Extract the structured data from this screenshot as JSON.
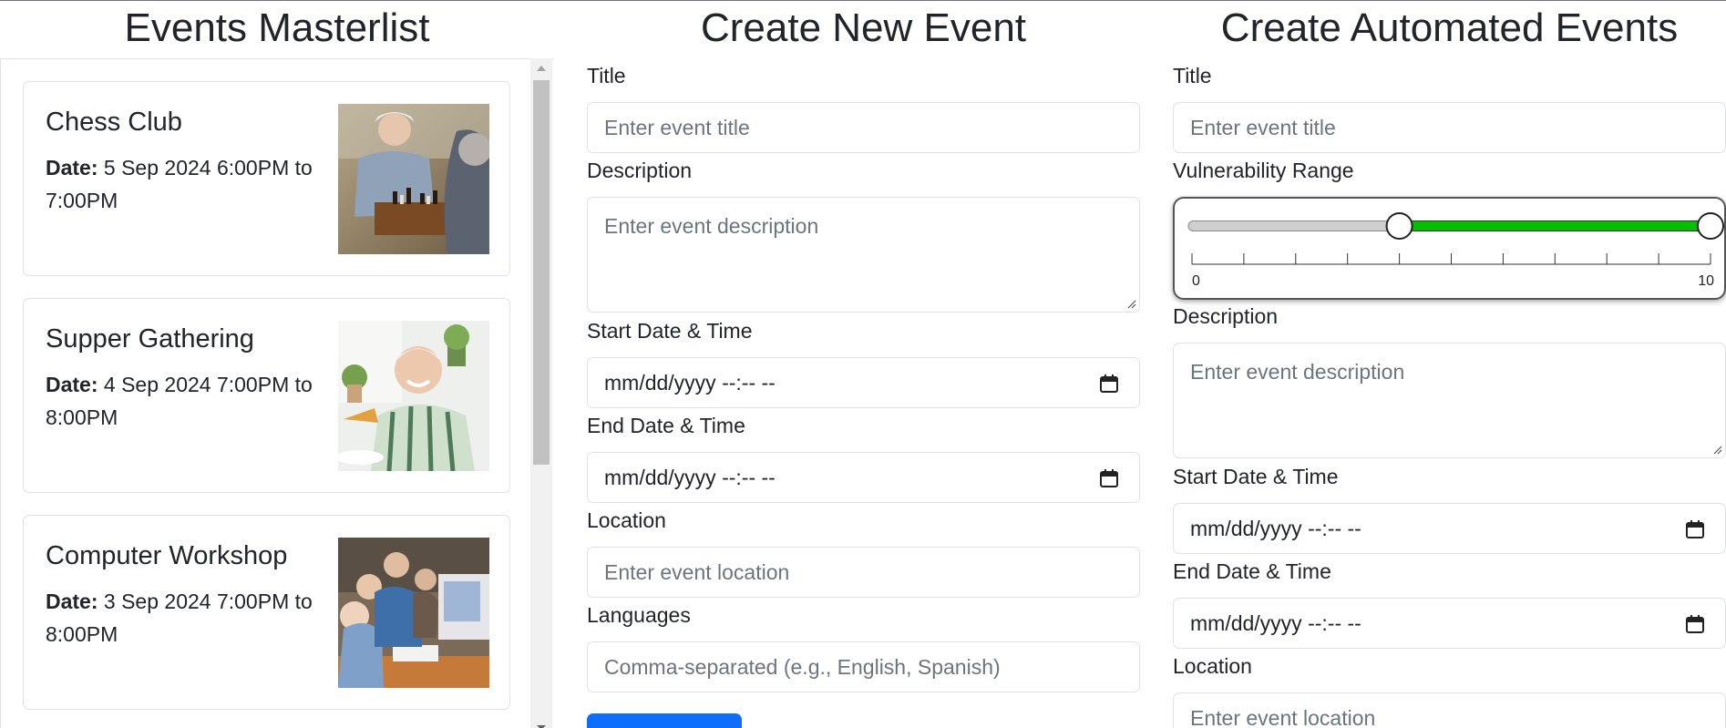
{
  "masterlist": {
    "title": "Events Masterlist",
    "events": [
      {
        "title": "Chess Club",
        "date_label": "Date:",
        "date_text": "5 Sep 2024 6:00PM to 7:00PM",
        "image": "chess-players-photo"
      },
      {
        "title": "Supper Gathering",
        "date_label": "Date:",
        "date_text": "4 Sep 2024 7:00PM to 8:00PM",
        "image": "man-eating-pizza-photo"
      },
      {
        "title": "Computer Workshop",
        "date_label": "Date:",
        "date_text": "3 Sep 2024 7:00PM to 8:00PM",
        "image": "seniors-at-computer-photo"
      }
    ]
  },
  "create_event": {
    "title": "Create New Event",
    "title_label": "Title",
    "title_placeholder": "Enter event title",
    "description_label": "Description",
    "description_placeholder": "Enter event description",
    "start_label": "Start Date & Time",
    "start_value": "mm/dd/yyyy --:-- --",
    "end_label": "End Date & Time",
    "end_value": "mm/dd/yyyy --:-- --",
    "location_label": "Location",
    "location_placeholder": "Enter event location",
    "languages_label": "Languages",
    "languages_placeholder": "Comma-separated (e.g., English, Spanish)"
  },
  "automated": {
    "title": "Create Automated Events",
    "title_label": "Title",
    "title_placeholder": "Enter event title",
    "range_label": "Vulnerability Range",
    "range": {
      "min": 0,
      "max": 10,
      "low": 4,
      "high": 10,
      "min_label": "0",
      "max_label": "10",
      "fill_color": "#00c000"
    },
    "description_label": "Description",
    "description_placeholder": "Enter event description",
    "start_label": "Start Date & Time",
    "start_value": "mm/dd/yyyy --:-- --",
    "end_label": "End Date & Time",
    "end_value": "mm/dd/yyyy --:-- --",
    "location_label": "Location",
    "location_placeholder": "Enter event location"
  },
  "colors": {
    "primary": "#0d6efd",
    "border": "#dee2e6",
    "placeholder": "#6c757d"
  }
}
